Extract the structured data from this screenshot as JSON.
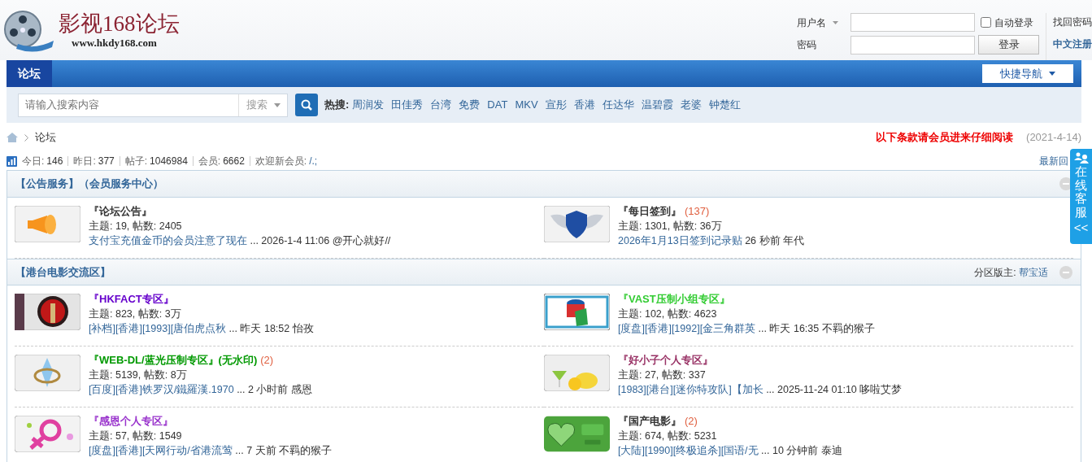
{
  "header": {
    "logo_title": "影视168论坛",
    "logo_url": "www.hkdy168.com"
  },
  "login": {
    "username_label": "用户名",
    "password_label": "密码",
    "auto_login_label": "自动登录",
    "auto_login_checked": false,
    "login_button": "登录",
    "find_password": "找回密码",
    "register": "中文注册"
  },
  "nav": {
    "tabs": [
      {
        "label": "论坛",
        "selected": true
      }
    ],
    "quick_nav": "快捷导航"
  },
  "search": {
    "placeholder": "请输入搜索内容",
    "type_label": "搜索",
    "hot_label": "热搜:",
    "hot": [
      "周润发",
      "田佳秀",
      "台湾",
      "免费",
      "DAT",
      "MKV",
      "宣彤",
      "香港",
      "任达华",
      "温碧霞",
      "老婆",
      "钟楚红"
    ]
  },
  "breadcrumb": [
    "论坛"
  ],
  "notice": {
    "text": "以下条款请会员进来仔细阅读",
    "date": "(2021-4-14)"
  },
  "stats": [
    {
      "label": "今日:",
      "value": "146"
    },
    {
      "label": "昨日:",
      "value": "377"
    },
    {
      "label": "帖子:",
      "value": "1046984"
    },
    {
      "label": "会员:",
      "value": "6662"
    },
    {
      "label": "欢迎新会员:",
      "value": "/.;"
    }
  ],
  "latest_link": "最新回",
  "side_tab": {
    "text": "在线客服",
    "collapse": "<<"
  },
  "categories": [
    {
      "title": "【公告服务】",
      "subtitle": "（会员服务中心）",
      "forums": [
        {
          "name": "『论坛公告』",
          "color": "#333333",
          "stats": "主题: 19, 帖数: 2405",
          "last_title": "支付宝充值金币的会员注意了现在",
          "last_info": "... 2026-1-4 11:06 @开心就好//"
        },
        {
          "name": "『每日签到』",
          "color": "#333333",
          "new_count": "(137)",
          "stats": "主题: 1301, 帖数: 36万",
          "last_title": "2026年1月13日签到记录贴",
          "last_info": "26 秒前 年代"
        }
      ]
    },
    {
      "title": "【港台电影交流区】",
      "moderator_label": "分区版主:",
      "moderator": "帮宝适",
      "forums": [
        {
          "name": "『HKFACT专区』",
          "color": "#6600cc",
          "stats": "主题: 823, 帖数: 3万",
          "last_title": "[补档][香港][1993][唐伯虎点秋",
          "last_info": "... 昨天 18:52 怡孜"
        },
        {
          "name": "『VAST压制小组专区』",
          "color": "#33cc33",
          "stats": "主题: 102, 帖数: 4623",
          "last_title": "[度盘][香港][1992][金三角群英",
          "last_info": "... 昨天 16:35 不羁的猴子"
        },
        {
          "name": "『WEB-DL/蓝光压制专区』(无水印)",
          "color": "#009900",
          "new_count": "(2)",
          "stats": "主题: 5139, 帖数: 8万",
          "last_title": "[百度][香港]铁罗汉/鐵羅漢.1970",
          "last_info": "... 2 小时前 感恩"
        },
        {
          "name": "『好小子个人专区』",
          "color": "#993366",
          "stats": "主题: 27, 帖数: 337",
          "last_title": "[1983][港台][迷你特攻队]【加长",
          "last_info": "... 2025-11-24 01:10 哆啦艾梦"
        },
        {
          "name": "『感恩个人专区』",
          "color": "#9933cc",
          "stats": "主题: 57, 帖数: 1549",
          "last_title": "[度盘][香港][天网行动/省港流莺",
          "last_info": "... 7 天前 不羁的猴子"
        },
        {
          "name": "『国产电影』",
          "color": "#333333",
          "new_count": "(2)",
          "stats": "主题: 674, 帖数: 5231",
          "last_title": "[大陆][1990][终极追杀][国语/无",
          "last_info": "... 10 分钟前 泰迪"
        }
      ]
    }
  ]
}
